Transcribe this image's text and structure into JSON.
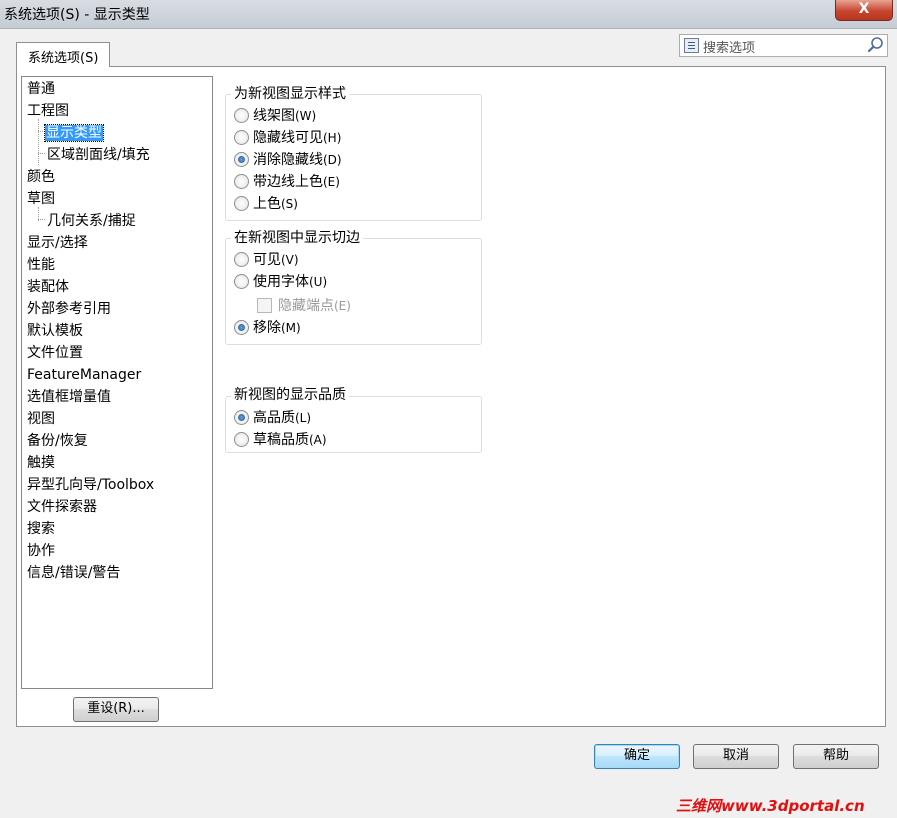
{
  "window": {
    "title": "系统选项(S) - 显示类型",
    "close_label": "X"
  },
  "tab": {
    "label": "系统选项(S)"
  },
  "search": {
    "placeholder": "搜索选项"
  },
  "tree": {
    "items": [
      {
        "label": "普通",
        "level": 0
      },
      {
        "label": "工程图",
        "level": 0
      },
      {
        "label": "显示类型",
        "level": 1,
        "selected": true
      },
      {
        "label": "区域剖面线/填充",
        "level": 1
      },
      {
        "label": "颜色",
        "level": 0
      },
      {
        "label": "草图",
        "level": 0
      },
      {
        "label": "几何关系/捕捉",
        "level": 1
      },
      {
        "label": "显示/选择",
        "level": 0
      },
      {
        "label": "性能",
        "level": 0
      },
      {
        "label": "装配体",
        "level": 0
      },
      {
        "label": "外部参考引用",
        "level": 0
      },
      {
        "label": "默认模板",
        "level": 0
      },
      {
        "label": "文件位置",
        "level": 0
      },
      {
        "label": "FeatureManager",
        "level": 0
      },
      {
        "label": "选值框增量值",
        "level": 0
      },
      {
        "label": "视图",
        "level": 0
      },
      {
        "label": "备份/恢复",
        "level": 0
      },
      {
        "label": "触摸",
        "level": 0
      },
      {
        "label": "异型孔向导/Toolbox",
        "level": 0
      },
      {
        "label": "文件探索器",
        "level": 0
      },
      {
        "label": "搜索",
        "level": 0
      },
      {
        "label": "协作",
        "level": 0
      },
      {
        "label": "信息/错误/警告",
        "level": 0
      }
    ]
  },
  "reset_button": "重设(R)...",
  "groups": {
    "display_style": {
      "title": "为新视图显示样式",
      "options": [
        {
          "label": "线架图",
          "key": "(W)",
          "checked": false
        },
        {
          "label": "隐藏线可见",
          "key": "(H)",
          "checked": false
        },
        {
          "label": "消除隐藏线",
          "key": "(D)",
          "checked": true
        },
        {
          "label": "带边线上色",
          "key": "(E)",
          "checked": false
        },
        {
          "label": "上色",
          "key": "(S)",
          "checked": false
        }
      ]
    },
    "tangent_edges": {
      "title": "在新视图中显示切边",
      "options": [
        {
          "label": "可见",
          "key": "(V)",
          "checked": false
        },
        {
          "label": "使用字体",
          "key": "(U)",
          "checked": false
        },
        {
          "label": "移除",
          "key": "(M)",
          "checked": true
        }
      ],
      "hide_endpoints": {
        "label": "隐藏端点",
        "key": "(E)",
        "checked": false,
        "enabled": false
      }
    },
    "quality": {
      "title": "新视图的显示品质",
      "options": [
        {
          "label": "高品质",
          "key": "(L)",
          "checked": true
        },
        {
          "label": "草稿品质",
          "key": "(A)",
          "checked": false
        }
      ]
    }
  },
  "footer": {
    "ok": "确定",
    "cancel": "取消",
    "help": "帮助"
  },
  "watermark": "三维网www.3dportal.cn"
}
